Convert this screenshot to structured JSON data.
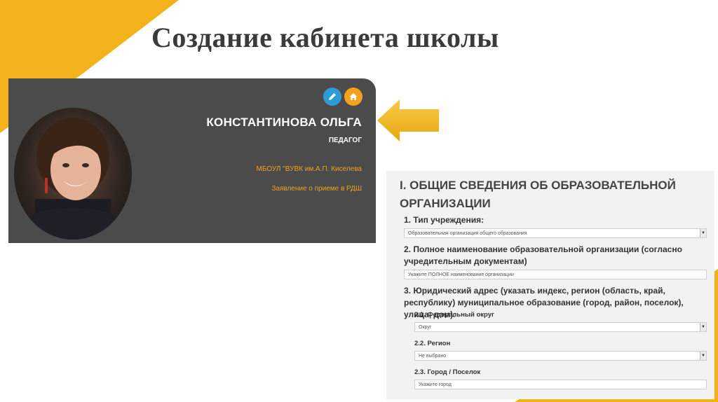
{
  "slide": {
    "title": "Создание кабинета школы"
  },
  "profile": {
    "name": "КОНСТАНТИНОВА ОЛЬГА",
    "role": "ПЕДАГОГ",
    "organization": "МБОУЛ \"ВУВК им.А.П. Киселева",
    "application_link": "Заявление о приеме в РДШ",
    "edit_icon": "pencil-icon",
    "home_icon": "home-icon"
  },
  "form": {
    "heading": "I. ОБЩИЕ СВЕДЕНИЯ ОБ ОБРАЗОВАТЕЛЬНОЙ ОРГАНИЗАЦИИ",
    "q1_label": "1. Тип учреждения:",
    "q1_value": "Образовательная организация общего образования",
    "q2_label": "2. Полное наименование образовательной организации (согласно учредительным документам)",
    "q2_placeholder": "Укажите ПОЛНОЕ наименование организации",
    "q3_label": "3. Юридический адрес (указать индекс, регион (область, край, республику) муниципальное образование (город, район, поселок), улица, дом).",
    "district_label": "2.1. Федеральный округ",
    "district_value": "Округ",
    "region_label": "2.2. Регион",
    "region_value": "Не выбрано",
    "city_label": "2.3. Город / Поселок",
    "city_placeholder": "Укажите город"
  },
  "colors": {
    "accent_yellow": "#f3b11c",
    "card_bg": "#4b4b4b",
    "link_orange": "#f3a11c",
    "edit_blue": "#2d9bd8"
  }
}
